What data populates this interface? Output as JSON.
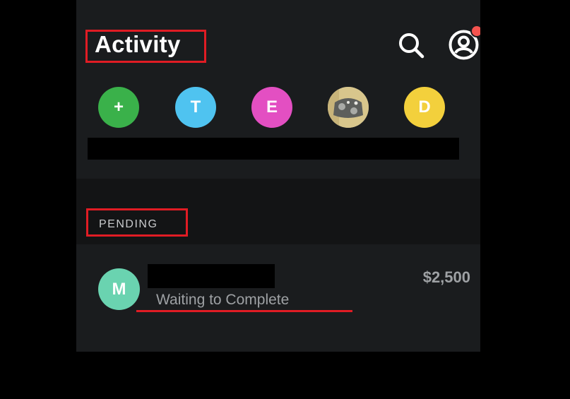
{
  "header": {
    "title": "Activity",
    "search_icon": "search-icon",
    "profile_icon": "profile-icon",
    "notification_badge_color": "#f5544f"
  },
  "contacts": [
    {
      "label": "+",
      "color": "#3ab14a",
      "kind": "add"
    },
    {
      "label": "T",
      "color": "#4fc3f0",
      "kind": "initial"
    },
    {
      "label": "E",
      "color": "#e34fc2",
      "kind": "initial"
    },
    {
      "label": "",
      "color": "#8b8a84",
      "kind": "photo"
    },
    {
      "label": "D",
      "color": "#f3d03c",
      "kind": "initial"
    }
  ],
  "pending": {
    "section_label": "PENDING",
    "items": [
      {
        "avatar_initial": "M",
        "avatar_color": "#6ad3b0",
        "status": "Waiting to Complete",
        "amount": "$2,500"
      }
    ]
  },
  "annotation_color": "#e01c24"
}
